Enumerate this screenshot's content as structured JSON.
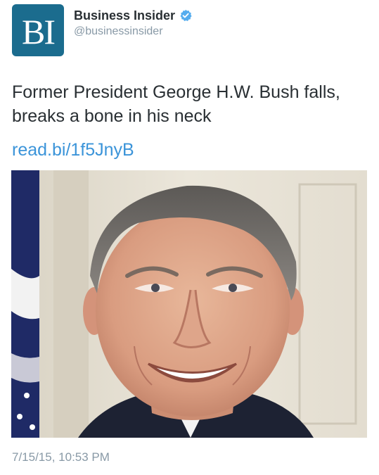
{
  "account": {
    "avatar_text": "BI",
    "display_name": "Business Insider",
    "handle": "@businessinsider",
    "verified": true,
    "avatar_color": "#1b6c8e"
  },
  "tweet": {
    "text": "Former President George H.W. Bush falls, breaks a bone in his neck",
    "link": "read.bi/1f5JnyB",
    "link_color": "#3b94d9",
    "timestamp": "7/15/15, 10:53 PM"
  },
  "media": {
    "icon": "portrait-photo"
  }
}
